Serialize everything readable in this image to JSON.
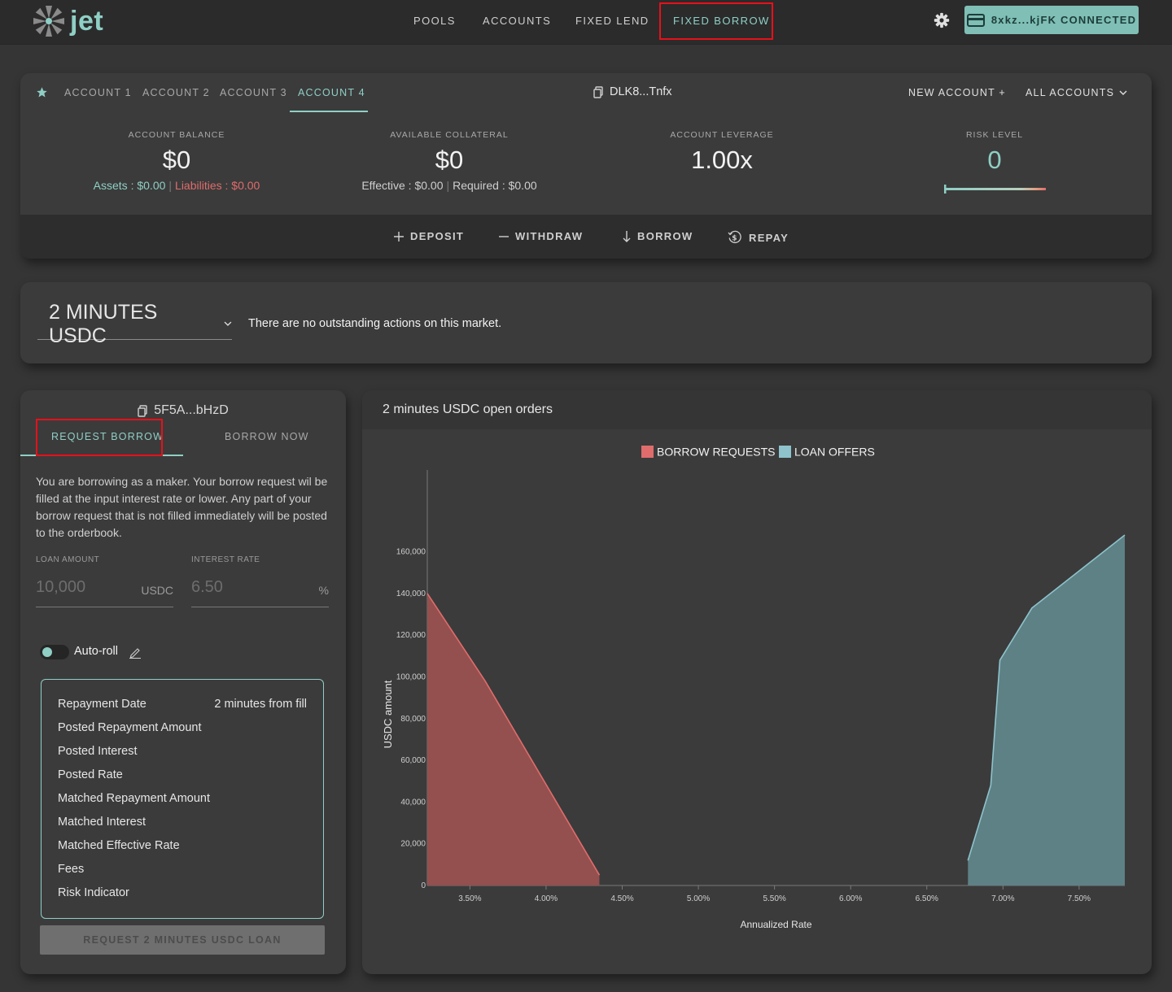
{
  "brand": {
    "name": "jet"
  },
  "nav": {
    "items": [
      "POOLS",
      "ACCOUNTS",
      "FIXED LEND",
      "FIXED BORROW"
    ],
    "active": "FIXED BORROW",
    "wallet": "8xkz...kjFK CONNECTED"
  },
  "account": {
    "tabs": [
      "ACCOUNT 1",
      "ACCOUNT 2",
      "ACCOUNT 3",
      "ACCOUNT 4"
    ],
    "active_tab": "ACCOUNT 4",
    "address": "DLK8...Tnfx",
    "new_account": "NEW ACCOUNT +",
    "all_accounts": "ALL ACCOUNTS",
    "stats": {
      "balance_label": "ACCOUNT BALANCE",
      "balance_value": "$0",
      "assets_label": "Assets : $0.00",
      "liabilities_label": "Liabilities : $0.00",
      "collateral_label": "AVAILABLE COLLATERAL",
      "collateral_value": "$0",
      "effective_label": "Effective : $0.00",
      "required_label": "Required : $0.00",
      "leverage_label": "ACCOUNT LEVERAGE",
      "leverage_value": "1.00x",
      "risk_label": "RISK LEVEL",
      "risk_value": "0"
    },
    "actions": {
      "deposit": "DEPOSIT",
      "withdraw": "WITHDRAW",
      "borrow": "BORROW",
      "repay": "REPAY"
    }
  },
  "market": {
    "selected": "2 MINUTES USDC",
    "message": "There are no outstanding actions on this market."
  },
  "form": {
    "address": "5F5A...bHzD",
    "tabs": [
      "REQUEST BORROW",
      "BORROW NOW"
    ],
    "active_tab": "REQUEST BORROW",
    "description": "You are borrowing as a maker. Your borrow request wil be filled at the input interest rate or lower. Any part of your borrow request that is not filled immediately will be posted to the orderbook.",
    "loan_amount_label": "LOAN AMOUNT",
    "loan_amount_placeholder": "10,000",
    "loan_amount_unit": "USDC",
    "interest_rate_label": "INTEREST RATE",
    "interest_rate_placeholder": "6.50",
    "interest_rate_unit": "%",
    "autoroll_label": "Auto-roll",
    "details": [
      {
        "label": "Repayment Date",
        "value": "2 minutes from fill"
      },
      {
        "label": "Posted Repayment Amount",
        "value": ""
      },
      {
        "label": "Posted Interest",
        "value": ""
      },
      {
        "label": "Posted Rate",
        "value": ""
      },
      {
        "label": "Matched Repayment Amount",
        "value": ""
      },
      {
        "label": "Matched Interest",
        "value": ""
      },
      {
        "label": "Matched Effective Rate",
        "value": ""
      },
      {
        "label": "Fees",
        "value": ""
      },
      {
        "label": "Risk Indicator",
        "value": ""
      }
    ],
    "submit_label": "REQUEST 2 MINUTES USDC LOAN"
  },
  "colors": {
    "accent": "#8fcfc5",
    "borrow": "#e06c6c",
    "highlight": "#e8101a"
  },
  "chart_title": "2 minutes USDC open orders",
  "chart_data": {
    "type": "area",
    "xlabel": "Annualized Rate",
    "ylabel": "USDC amount",
    "xlim": [
      3.22,
      7.8
    ],
    "ylim": [
      0,
      168000
    ],
    "x_ticks": [
      3.5,
      4.0,
      4.5,
      5.0,
      5.5,
      6.0,
      6.5,
      7.0,
      7.5
    ],
    "x_tick_labels": [
      "3.50%",
      "4.00%",
      "4.50%",
      "5.00%",
      "5.50%",
      "6.00%",
      "6.50%",
      "7.00%",
      "7.50%"
    ],
    "y_ticks": [
      0,
      20000,
      40000,
      60000,
      80000,
      100000,
      120000,
      140000,
      160000
    ],
    "y_tick_labels": [
      "0",
      "20,000",
      "40,000",
      "60,000",
      "80,000",
      "100,000",
      "120,000",
      "140,000",
      "160,000"
    ],
    "legend": "top-center",
    "series": [
      {
        "name": "BORROW REQUESTS",
        "color": "#e06c6c",
        "points": [
          [
            3.22,
            140000
          ],
          [
            3.6,
            98000
          ],
          [
            4.35,
            5000
          ]
        ]
      },
      {
        "name": "LOAN OFFERS",
        "color": "#8ec3cc",
        "points": [
          [
            6.77,
            12000
          ],
          [
            6.92,
            48000
          ],
          [
            6.98,
            108000
          ],
          [
            7.19,
            133000
          ],
          [
            7.8,
            168000
          ]
        ]
      }
    ]
  }
}
